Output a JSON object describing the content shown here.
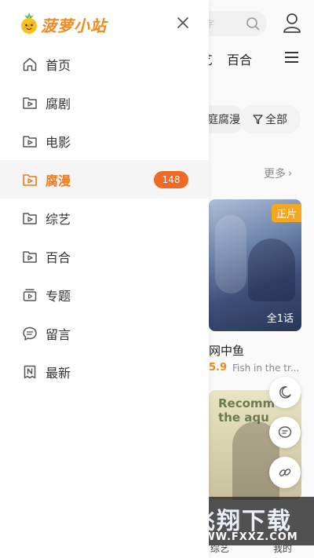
{
  "app": {
    "name": "菠萝小站",
    "brand_color": "#f18a20",
    "accent_color": "#f06a24"
  },
  "drawer": {
    "close_icon": "close-icon",
    "menu": [
      {
        "label": "首页",
        "icon": "home-icon",
        "active": false
      },
      {
        "label": "腐剧",
        "icon": "play-folder-icon",
        "active": false
      },
      {
        "label": "电影",
        "icon": "play-folder-icon",
        "active": false
      },
      {
        "label": "腐漫",
        "icon": "play-folder-icon",
        "active": true,
        "badge": "148"
      },
      {
        "label": "综艺",
        "icon": "play-folder-icon",
        "active": false
      },
      {
        "label": "百合",
        "icon": "play-folder-icon",
        "active": false
      },
      {
        "label": "专题",
        "icon": "topic-icon",
        "active": false
      },
      {
        "label": "留言",
        "icon": "message-icon",
        "active": false
      },
      {
        "label": "最新",
        "icon": "new-icon",
        "active": false
      }
    ]
  },
  "background": {
    "search_placeholder": "字",
    "tabs": [
      "艺",
      "百合"
    ],
    "filter_partial": "庭腐漫",
    "filter_all": "全部",
    "more_label": "更多",
    "card1": {
      "tag": "正片",
      "episodes": "全1话",
      "title": "网中鱼",
      "score": "5.9",
      "subtitle": "Fish in the tr..."
    },
    "card2": {
      "cover_text": "Recomm the aqu"
    },
    "watermark": {
      "text": "飞翔下载",
      "url": "WWW.FXXZ.COM"
    },
    "bottom_nav": [
      "综艺",
      "我的"
    ]
  }
}
